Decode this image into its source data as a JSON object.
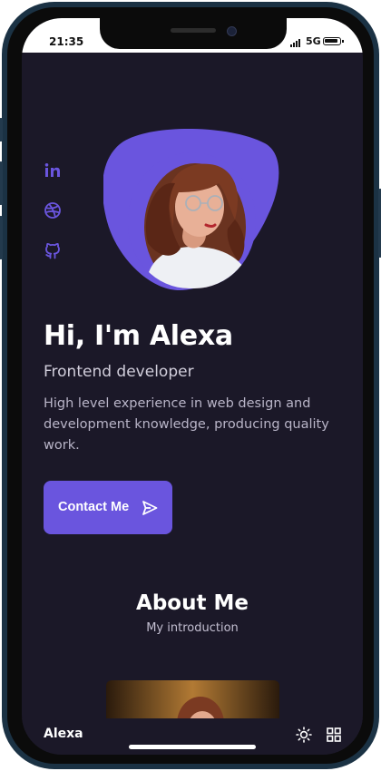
{
  "status_bar": {
    "time": "21:35",
    "network": "5G"
  },
  "social": {
    "icons": [
      "linkedin-icon",
      "dribbble-icon",
      "github-icon"
    ]
  },
  "home": {
    "title": "Hi, I'm Alexa",
    "subtitle": "Frontend developer",
    "description": "High level experience in web design and development knowledge, producing quality work.",
    "contact_button": "Contact Me"
  },
  "about": {
    "title": "About Me",
    "subtitle": "My introduction"
  },
  "nav": {
    "logo": "Alexa",
    "theme_icon": "sun-icon",
    "menu_icon": "grid-icon"
  },
  "colors": {
    "accent": "#6A55DE",
    "background": "#1B1828",
    "title": "#FFFFFF",
    "text": "#B9B5C8"
  }
}
